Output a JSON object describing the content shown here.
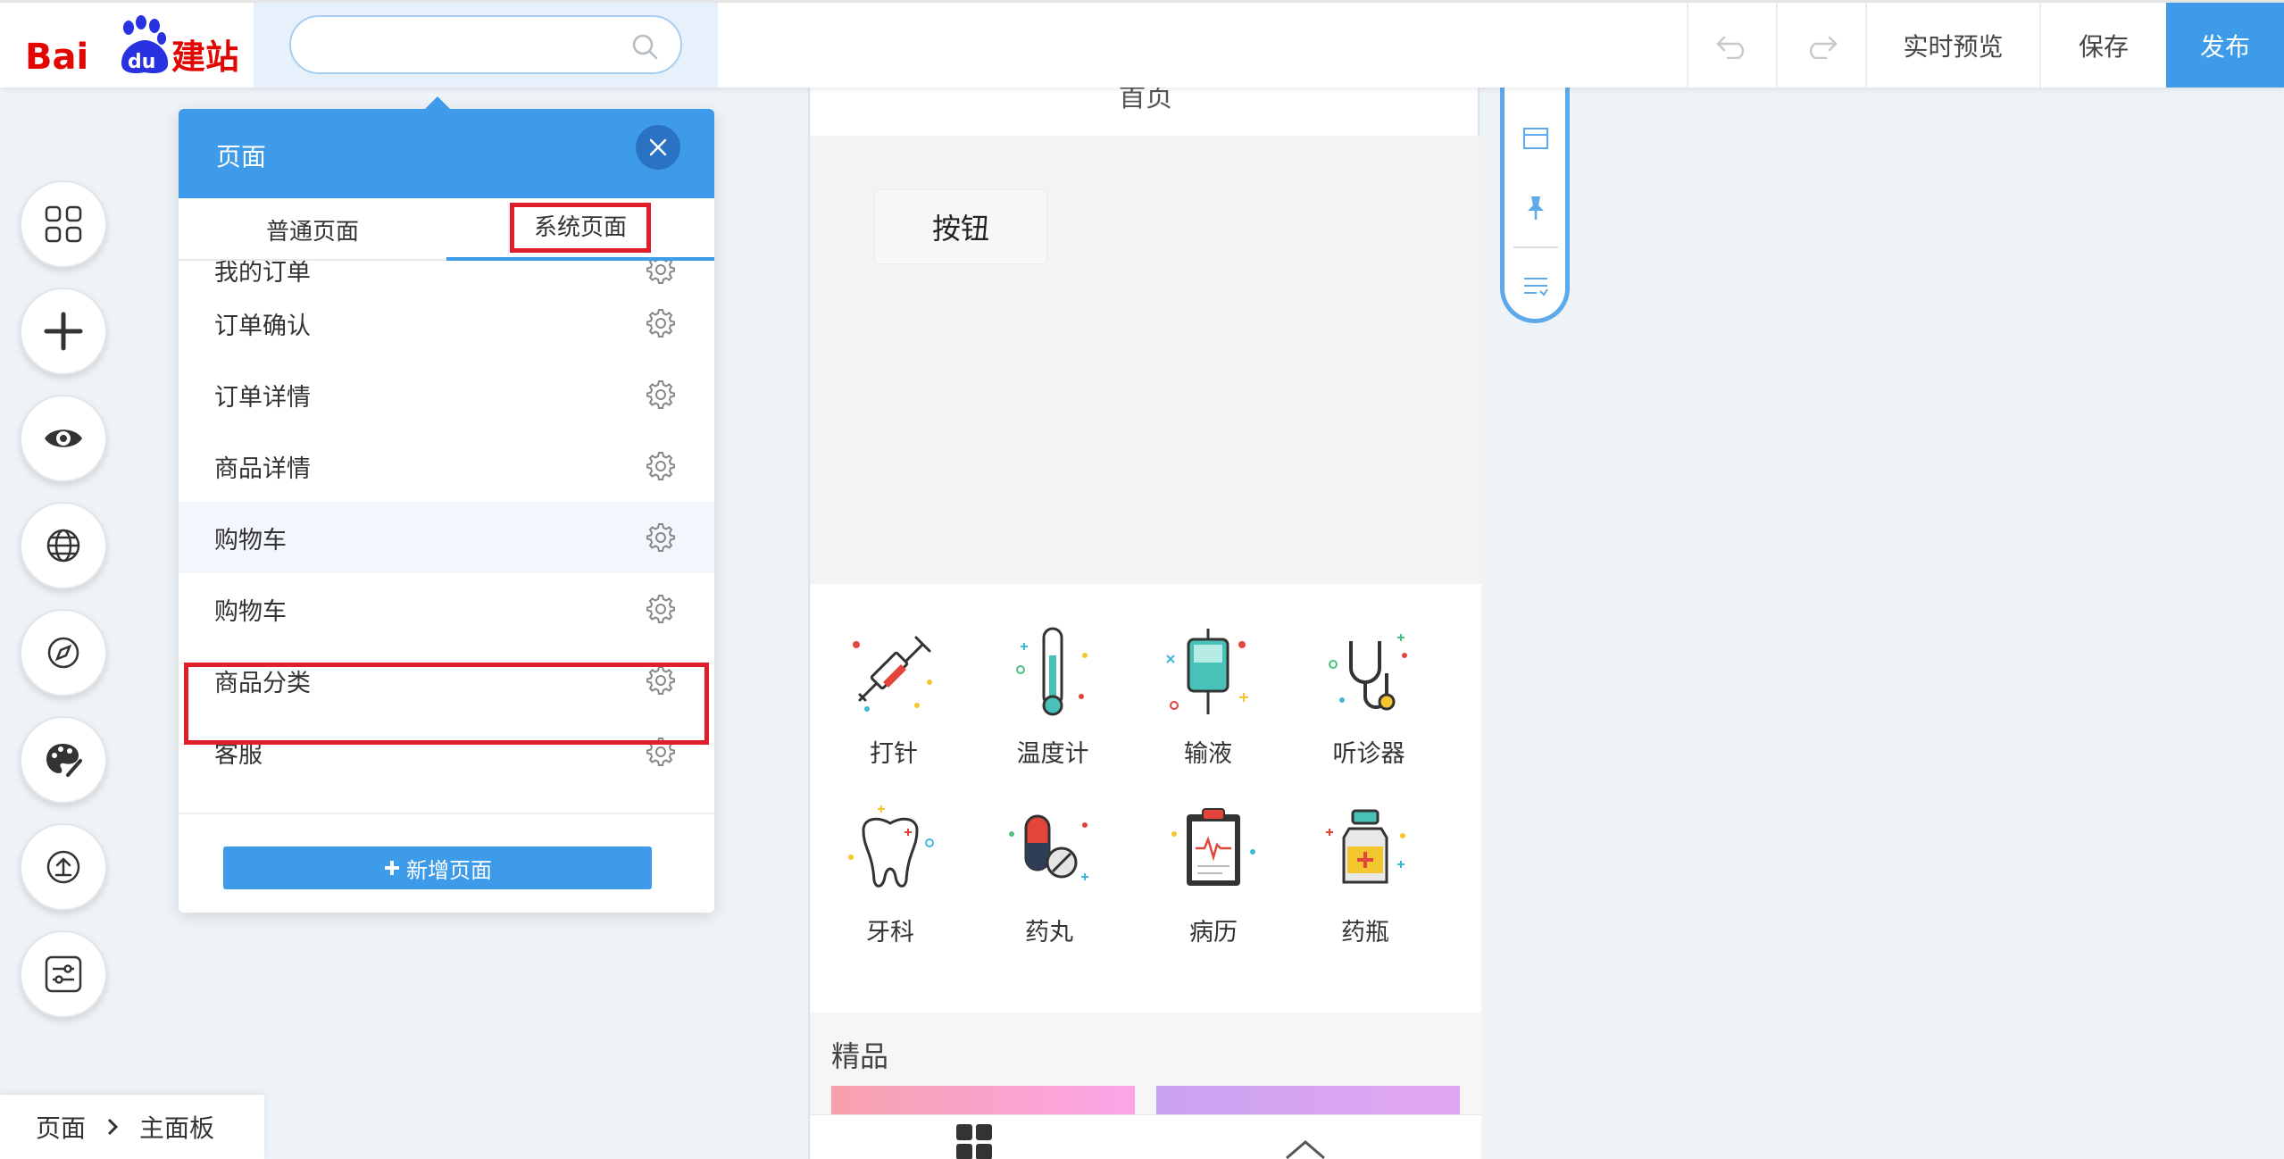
{
  "topbar": {
    "logo_text_bai": "Bai",
    "logo_text_du": "du",
    "logo_text_cn": "建站",
    "search_placeholder": "",
    "preview_label": "实时预览",
    "save_label": "保存",
    "publish_label": "发布"
  },
  "colors": {
    "accent": "#3d9be9",
    "highlight_red": "#e11f2a"
  },
  "panel": {
    "title": "页面",
    "tabs": [
      {
        "label": "普通页面"
      },
      {
        "label": "系统页面"
      }
    ],
    "pages": [
      {
        "label": "我的订单"
      },
      {
        "label": "订单确认"
      },
      {
        "label": "订单详情"
      },
      {
        "label": "商品详情"
      },
      {
        "label": "购物车"
      },
      {
        "label": "购物车"
      },
      {
        "label": "商品分类"
      },
      {
        "label": "客服"
      }
    ],
    "add_page_label": "新增页面"
  },
  "canvas": {
    "page_title": "首页",
    "demo_button_label": "按钮",
    "icons": [
      {
        "label": "打针",
        "icon": "syringe-icon"
      },
      {
        "label": "温度计",
        "icon": "thermometer-icon"
      },
      {
        "label": "输液",
        "icon": "iv-drip-icon"
      },
      {
        "label": "听诊器",
        "icon": "stethoscope-icon"
      },
      {
        "label": "牙科",
        "icon": "tooth-icon"
      },
      {
        "label": "药丸",
        "icon": "pills-icon"
      },
      {
        "label": "病历",
        "icon": "medical-record-icon"
      },
      {
        "label": "药瓶",
        "icon": "medicine-bottle-icon"
      }
    ],
    "featured_title": "精品"
  },
  "breadcrumb": {
    "root": "页面",
    "current": "主面板"
  }
}
